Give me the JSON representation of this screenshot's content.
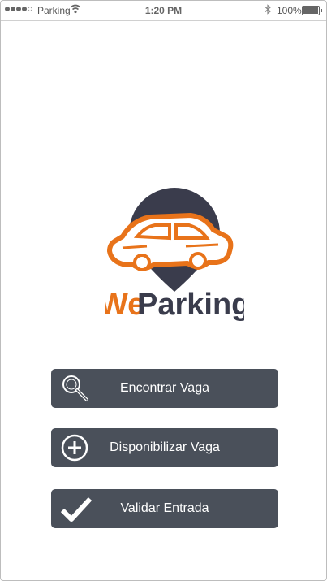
{
  "status_bar": {
    "carrier": "Parking",
    "time": "1:20 PM",
    "battery_text": "100%",
    "battery_level": 1.0,
    "signal_bars_filled": 4,
    "signal_bars_total": 5,
    "icons": [
      "wifi-icon",
      "bluetooth-icon",
      "battery-icon"
    ]
  },
  "logo": {
    "text_part1": "We",
    "text_part2": "Parking",
    "colors": {
      "accent": "#e8731a",
      "dark": "#3a3c4c"
    }
  },
  "actions": [
    {
      "label": "Encontrar Vaga",
      "icon": "search-icon"
    },
    {
      "label": "Disponibilizar Vaga",
      "icon": "plus-circle-icon"
    },
    {
      "label": "Validar Entrada",
      "icon": "checkmark-icon"
    }
  ],
  "colors": {
    "button_bg": "#4a505a",
    "button_text": "#ffffff",
    "background": "#ffffff"
  }
}
